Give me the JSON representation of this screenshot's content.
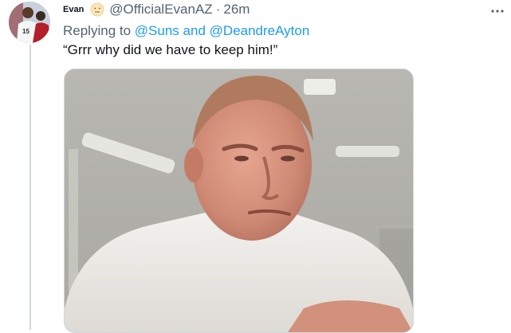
{
  "author": {
    "display_name": "Evan",
    "emoji_icon": "neutral-face-emoji-icon",
    "handle": "@OfficialEvanAZ",
    "separator": "·",
    "time": "26m"
  },
  "reply": {
    "prefix": "Replying to",
    "mention_1": "@Suns",
    "connector": "and",
    "mention_2": "@DeandreAyton"
  },
  "tweet": {
    "text": "“Grrr why did we have to keep him!”"
  },
  "icons": {
    "more": "more-options-icon",
    "avatar": "avatar-basketball-player"
  },
  "colors": {
    "link": "#1d9bf0",
    "secondary_text": "#536471",
    "thread_line": "#cfd9de"
  }
}
